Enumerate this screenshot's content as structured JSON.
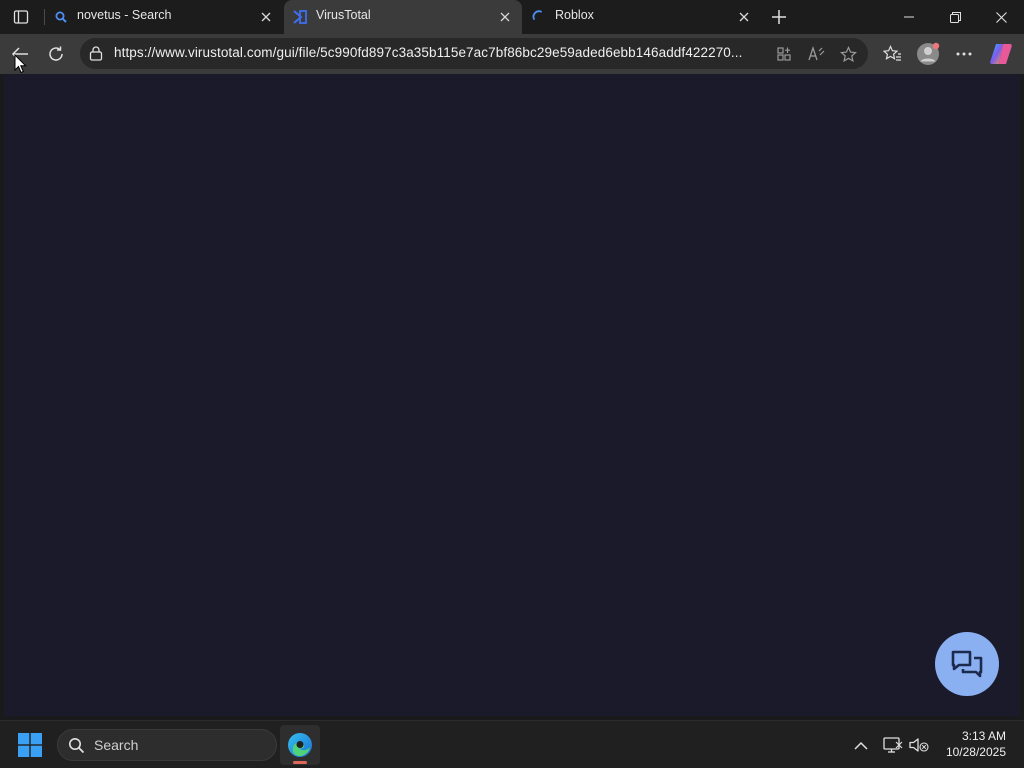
{
  "browser": {
    "tabs": [
      {
        "title": "novetus - Search",
        "icon": "search-icon",
        "active": false
      },
      {
        "title": "VirusTotal",
        "icon": "virustotal-icon",
        "active": true
      },
      {
        "title": "Roblox",
        "icon": "loading-spinner-icon",
        "active": false
      }
    ],
    "address_bar": {
      "url": "https://www.virustotal.com/gui/file/5c990fd897c3a35b115e7ac7bf86bc29e59aded6ebb146addf422270..."
    }
  },
  "taskbar": {
    "search_label": "Search",
    "clock": {
      "time": "3:13 AM",
      "date": "10/28/2025"
    }
  },
  "colors": {
    "content_bg": "#1b1a2b",
    "chat_button": "#8ab0f2",
    "active_tab": "#3b3b3b"
  }
}
